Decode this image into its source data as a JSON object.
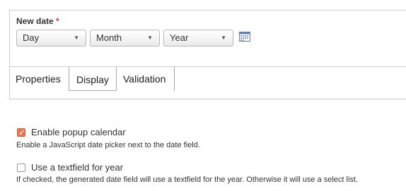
{
  "new_date": {
    "label": "New date",
    "required_mark": "*",
    "selects": [
      {
        "value": "Day"
      },
      {
        "value": "Month"
      },
      {
        "value": "Year"
      }
    ],
    "calendar_icon": "calendar-icon"
  },
  "tabs": [
    {
      "label": "Properties"
    },
    {
      "label": "Display"
    },
    {
      "label": "Validation"
    }
  ],
  "options": [
    {
      "label": "Enable popup calendar",
      "checked": true,
      "description": "Enable a JavaScript date picker next to the date field."
    },
    {
      "label": "Use a textfield for year",
      "checked": false,
      "description": "If checked, the generated date field will use a textfield for the year. Otherwise it will use a select list."
    }
  ],
  "colors": {
    "required": "#e03030",
    "checkbox_checked": "#e8774f"
  }
}
